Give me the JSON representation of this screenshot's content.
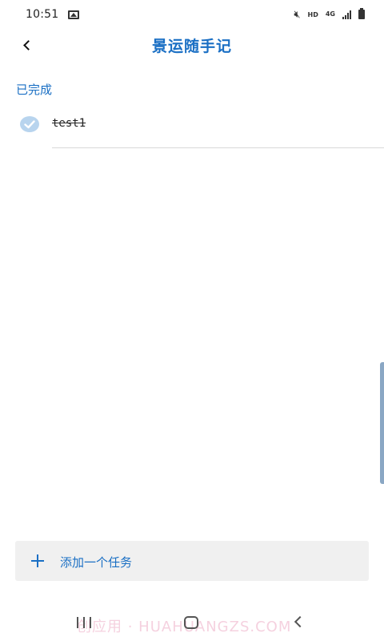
{
  "status_bar": {
    "time": "10:51",
    "hd": "HD",
    "network": "4G"
  },
  "app_bar": {
    "title": "景运随手记"
  },
  "sections": {
    "completed": {
      "label": "已完成",
      "tasks": [
        {
          "text": "test1",
          "done": true
        }
      ]
    }
  },
  "add_task": {
    "label": "添加一个任务"
  },
  "watermark": {
    "text": "创应用 · HUAHUANGZS.COM"
  },
  "colors": {
    "accent": "#1a6fc4",
    "check_fill": "#b8d4ee",
    "add_bar_bg": "#f0f0f0"
  },
  "icons": {
    "back": "chevron-left-icon",
    "check": "check-circle-icon",
    "add": "plus-icon"
  }
}
